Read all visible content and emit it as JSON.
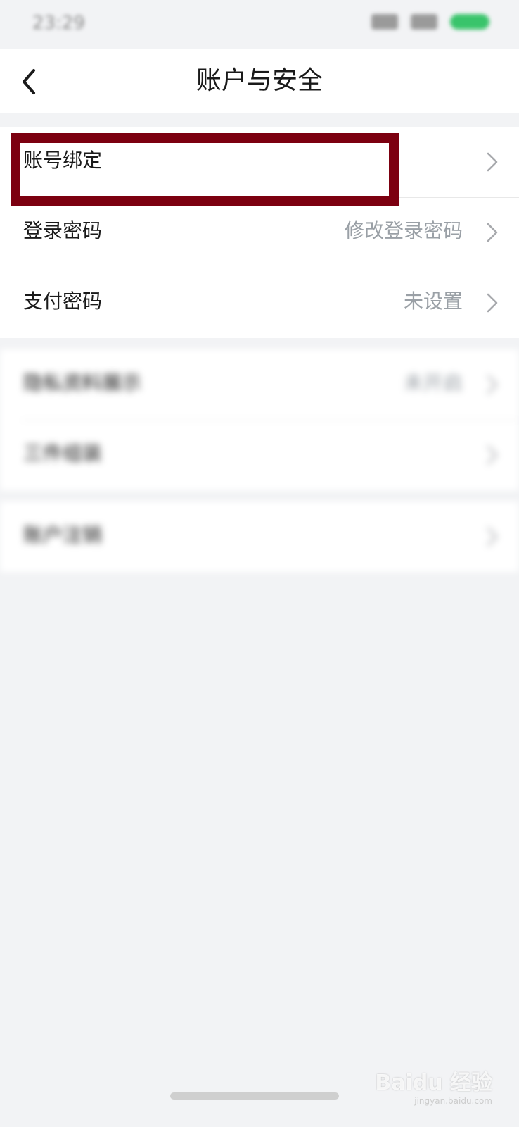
{
  "status_bar": {
    "time": "23:29"
  },
  "header": {
    "title": "账户与安全"
  },
  "groups": [
    {
      "items": [
        {
          "label": "账号绑定",
          "value": ""
        },
        {
          "label": "登录密码",
          "value": "修改登录密码"
        },
        {
          "label": "支付密码",
          "value": "未设置"
        }
      ]
    },
    {
      "items": [
        {
          "label": "隐私资料展示",
          "value": "未开启"
        },
        {
          "label": "三件组装",
          "value": ""
        }
      ]
    },
    {
      "items": [
        {
          "label": "账户注销",
          "value": ""
        }
      ]
    }
  ],
  "watermark": {
    "logo": "Baidu 经验",
    "url": "jingyan.baidu.com"
  },
  "colors": {
    "highlight": "#7c0010",
    "page_bg": "#f2f3f5",
    "value_text": "#9aa0a6"
  }
}
